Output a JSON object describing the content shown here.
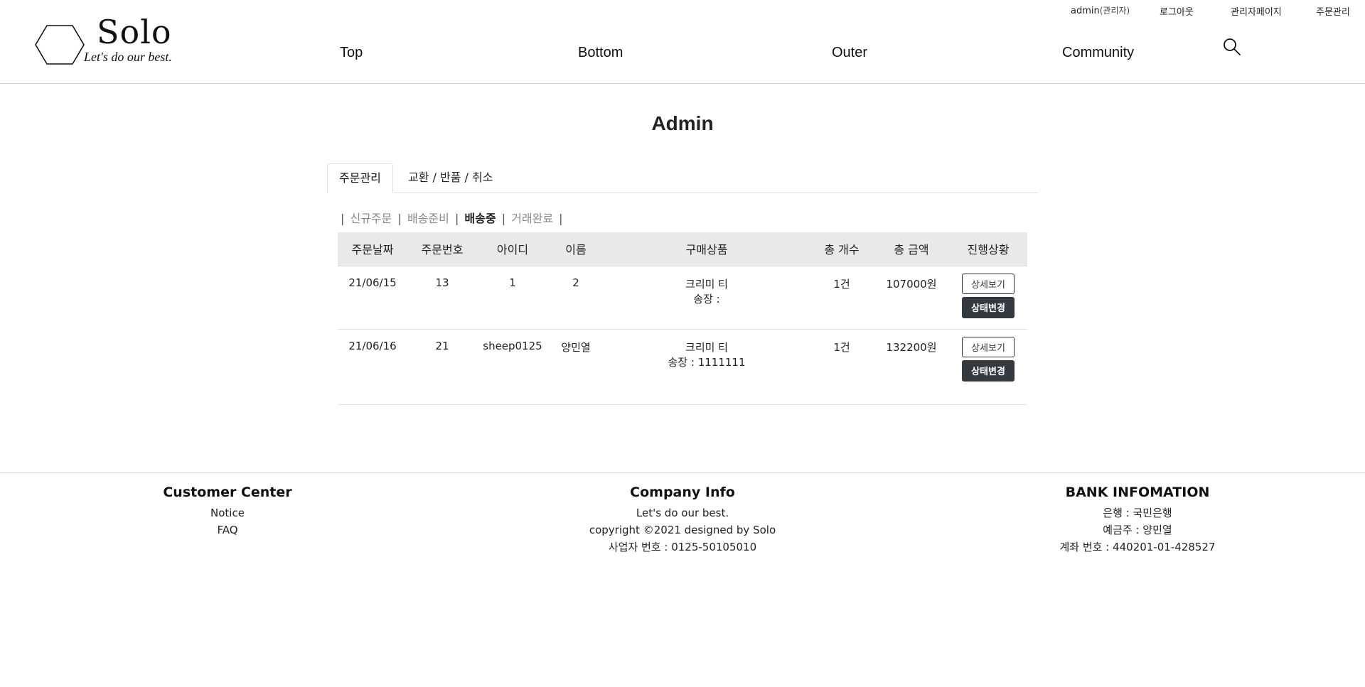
{
  "header": {
    "user_label": "admin",
    "user_role": "(관리자)",
    "logout": "로그아웃",
    "admin_page": "관리자페이지",
    "order_manage": "주문관리",
    "logo_title": "Solo",
    "logo_tagline": "Let's do our best.",
    "nav": [
      "Top",
      "Bottom",
      "Outer",
      "Community"
    ],
    "search_icon": "search-icon"
  },
  "main": {
    "title": "Admin",
    "tabs": [
      {
        "label": "주문관리",
        "active": true
      },
      {
        "label": "교환 / 반품 / 취소",
        "active": false
      }
    ],
    "status_filters": [
      {
        "label": "신규주문",
        "active": false
      },
      {
        "label": "배송준비",
        "active": false
      },
      {
        "label": "배송중",
        "active": true
      },
      {
        "label": "거래완료",
        "active": false
      }
    ],
    "table": {
      "columns": [
        "주문날짜",
        "주문번호",
        "아이디",
        "이름",
        "구매상품",
        "총 개수",
        "총 금액",
        "진행상황"
      ],
      "rows": [
        {
          "date": "21/06/15",
          "order_no": "13",
          "user_id": "1",
          "name": "2",
          "product": "크리미 티",
          "invoice": "송장 :",
          "count": "1건",
          "amount": "107000원"
        },
        {
          "date": "21/06/16",
          "order_no": "21",
          "user_id": "sheep0125",
          "name": "양민열",
          "product": "크리미 티",
          "invoice": "송장 : 1111111",
          "count": "1건",
          "amount": "132200원"
        }
      ],
      "detail_button": "상세보기",
      "status_button": "상태변경"
    }
  },
  "footer": {
    "customer": {
      "title": "Customer Center",
      "links": [
        "Notice",
        "FAQ"
      ]
    },
    "company": {
      "title": "Company Info",
      "lines": [
        "Let's do our best.",
        "copyright ©2021 designed by Solo",
        "사업자 번호 : 0125-50105010"
      ]
    },
    "bank": {
      "title": "BANK INFOMATION",
      "lines": [
        "은행 : 국민은행",
        "예금주 : 양민열",
        "계좌 번호 : 440201-01-428527"
      ]
    }
  }
}
